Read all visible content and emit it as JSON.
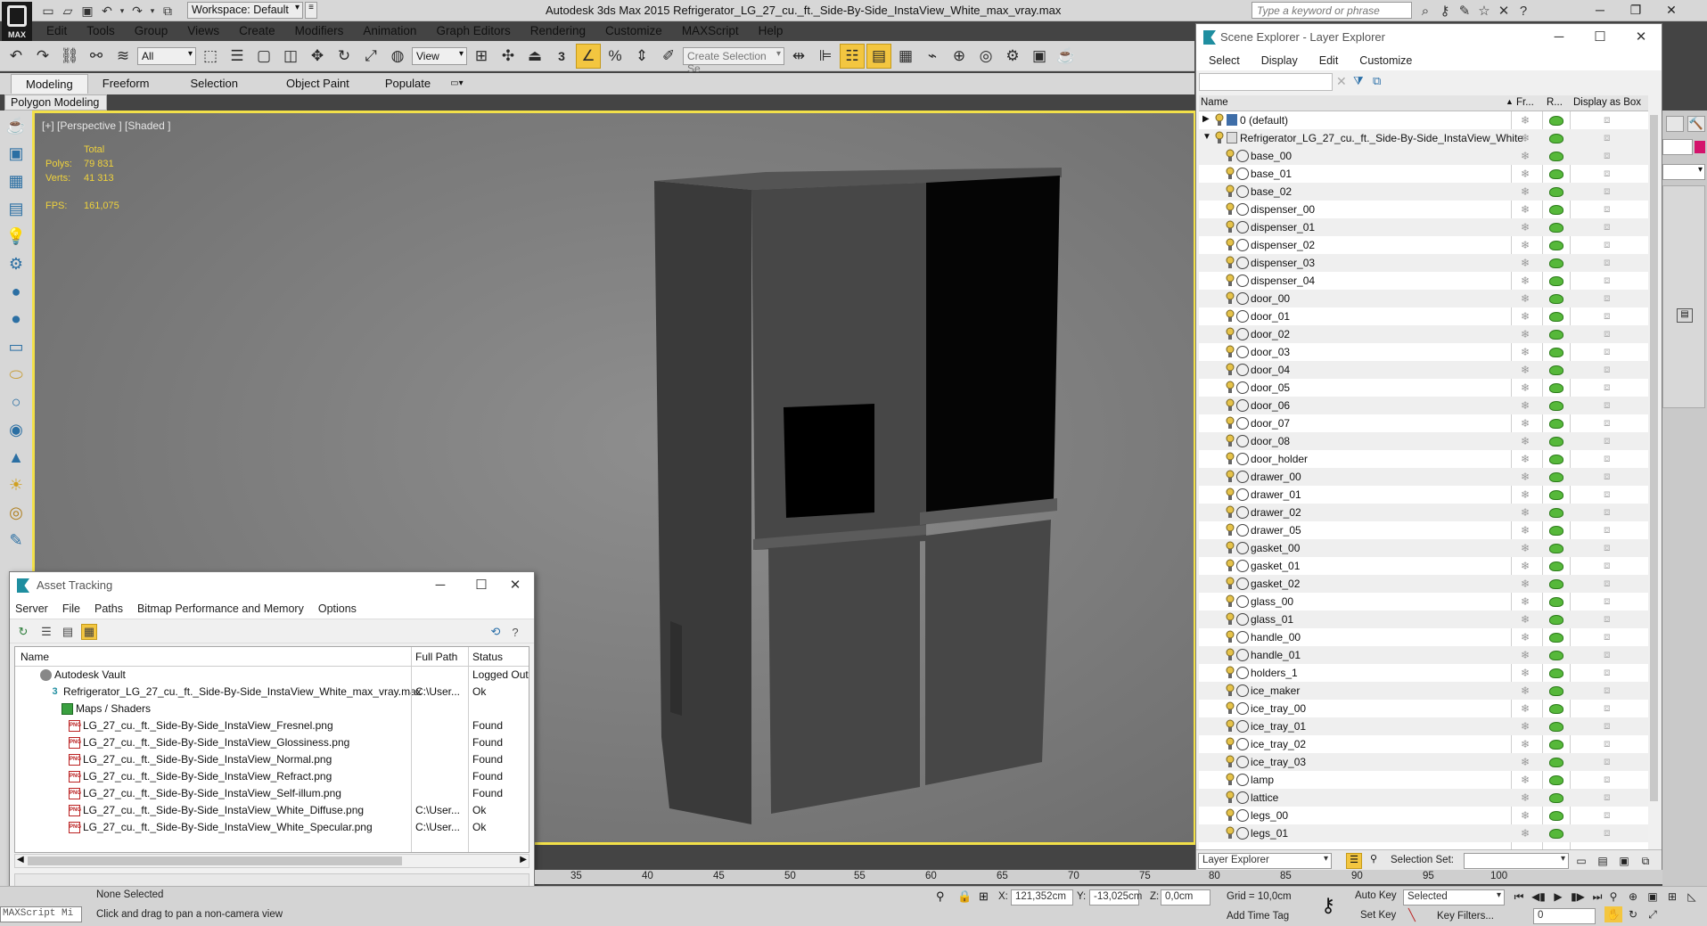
{
  "title_bar": {
    "workspace": "Workspace: Default",
    "app_title": "Autodesk 3ds Max  2015     Refrigerator_LG_27_cu._ft._Side-By-Side_InstaView_White_max_vray.max",
    "search_placeholder": "Type a keyword or phrase",
    "logo_label": "MAX"
  },
  "menu": [
    "Edit",
    "Tools",
    "Group",
    "Views",
    "Create",
    "Modifiers",
    "Animation",
    "Graph Editors",
    "Rendering",
    "Customize",
    "MAXScript",
    "Help"
  ],
  "toolbar": {
    "selection_filter": "All",
    "ref_coord": "View",
    "selection_set_placeholder": "Create Selection Se",
    "snap_label": "3"
  },
  "ribbon": {
    "tabs": [
      "Modeling",
      "Freeform",
      "Selection",
      "Object Paint",
      "Populate"
    ],
    "active_tab": "Modeling",
    "subpanel": "Polygon Modeling"
  },
  "viewport": {
    "label": "[+] [Perspective ] [Shaded ]",
    "stats": {
      "total_label": "Total",
      "polys_label": "Polys:",
      "polys_value": "79 831",
      "verts_label": "Verts:",
      "verts_value": "41 313",
      "fps_label": "FPS:",
      "fps_value": "161,075"
    },
    "colors": {
      "highlight_border": "#f2e049",
      "stats_text": "#efd23c"
    }
  },
  "asset_tracking": {
    "title": "Asset Tracking",
    "menus": [
      "Server",
      "File",
      "Paths",
      "Bitmap Performance and Memory",
      "Options"
    ],
    "columns": {
      "name": "Name",
      "full_path": "Full Path",
      "status": "Status"
    },
    "rows": [
      {
        "name": "Autodesk Vault",
        "path": "",
        "status": "Logged Out",
        "icon": "vault-icon",
        "indent": 1
      },
      {
        "name": "Refrigerator_LG_27_cu._ft._Side-By-Side_InstaView_White_max_vray.max",
        "path": "C:\\User...",
        "status": "Ok",
        "icon": "max-file-icon",
        "indent": 2
      },
      {
        "name": "Maps / Shaders",
        "path": "",
        "status": "",
        "icon": "folder-icon",
        "indent": 3
      },
      {
        "name": "LG_27_cu._ft._Side-By-Side_InstaView_Fresnel.png",
        "path": "",
        "status": "Found",
        "icon": "png-icon",
        "indent": 4
      },
      {
        "name": "LG_27_cu._ft._Side-By-Side_InstaView_Glossiness.png",
        "path": "",
        "status": "Found",
        "icon": "png-icon",
        "indent": 4
      },
      {
        "name": "LG_27_cu._ft._Side-By-Side_InstaView_Normal.png",
        "path": "",
        "status": "Found",
        "icon": "png-icon",
        "indent": 4
      },
      {
        "name": "LG_27_cu._ft._Side-By-Side_InstaView_Refract.png",
        "path": "",
        "status": "Found",
        "icon": "png-icon",
        "indent": 4
      },
      {
        "name": "LG_27_cu._ft._Side-By-Side_InstaView_Self-illum.png",
        "path": "",
        "status": "Found",
        "icon": "png-icon",
        "indent": 4
      },
      {
        "name": "LG_27_cu._ft._Side-By-Side_InstaView_White_Diffuse.png",
        "path": "C:\\User...",
        "status": "Ok",
        "icon": "png-icon",
        "indent": 4
      },
      {
        "name": "LG_27_cu._ft._Side-By-Side_InstaView_White_Specular.png",
        "path": "C:\\User...",
        "status": "Ok",
        "icon": "png-icon",
        "indent": 4
      }
    ]
  },
  "scene_explorer": {
    "title": "Scene Explorer - Layer Explorer",
    "menus": [
      "Select",
      "Display",
      "Edit",
      "Customize"
    ],
    "columns": {
      "name": "Name",
      "frozen": "Fr...",
      "render": "R...",
      "box": "Display as Box"
    },
    "layers": [
      {
        "name": "0 (default)",
        "level": 0,
        "expander": "right"
      },
      {
        "name": "Refrigerator_LG_27_cu._ft._Side-By-Side_InstaView_White",
        "level": 0,
        "expander": "down"
      }
    ],
    "objects": [
      "base_00",
      "base_01",
      "base_02",
      "dispenser_00",
      "dispenser_01",
      "dispenser_02",
      "dispenser_03",
      "dispenser_04",
      "door_00",
      "door_01",
      "door_02",
      "door_03",
      "door_04",
      "door_05",
      "door_06",
      "door_07",
      "door_08",
      "door_holder",
      "drawer_00",
      "drawer_01",
      "drawer_02",
      "drawer_05",
      "gasket_00",
      "gasket_01",
      "gasket_02",
      "glass_00",
      "glass_01",
      "handle_00",
      "handle_01",
      "holders_1",
      "ice_maker",
      "ice_tray_00",
      "ice_tray_01",
      "ice_tray_02",
      "ice_tray_03",
      "lamp",
      "lattice",
      "legs_00",
      "legs_01"
    ],
    "footer_mode": "Layer Explorer",
    "selection_set_label": "Selection Set:"
  },
  "timeline": {
    "ticks": [
      "35",
      "40",
      "45",
      "50",
      "55",
      "60",
      "65",
      "70",
      "75",
      "80",
      "85",
      "90",
      "95",
      "100"
    ]
  },
  "status_bar": {
    "maxscript": "MAXScript Mi",
    "none_selected": "None Selected",
    "prompt": "Click and drag to pan a non-camera view",
    "x_label": "X:",
    "x_value": "121,352cm",
    "y_label": "Y:",
    "y_value": "-13,025cm",
    "z_label": "Z:",
    "z_value": "0,0cm",
    "grid": "Grid = 10,0cm",
    "add_time_tag": "Add Time Tag",
    "auto_key": "Auto Key",
    "set_key": "Set Key",
    "key_mode": "Selected",
    "key_filters": "Key Filters...",
    "frame": "0"
  }
}
